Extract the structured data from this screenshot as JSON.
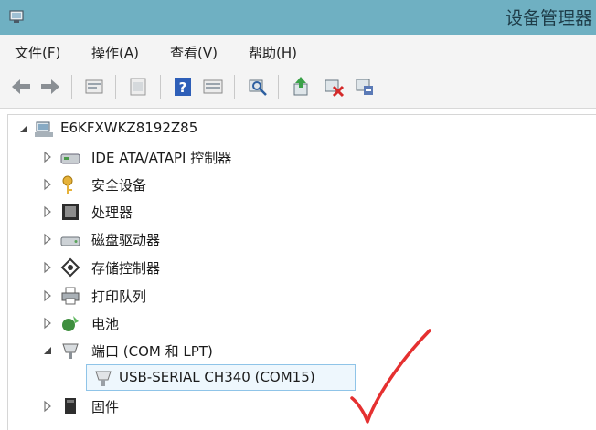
{
  "window": {
    "title": "设备管理器"
  },
  "menu": {
    "items": [
      "文件(F)",
      "操作(A)",
      "查看(V)",
      "帮助(H)"
    ]
  },
  "toolbar": {
    "buttons": [
      "back-arrow-icon",
      "forward-arrow-icon",
      "properties-icon",
      "show-hidden-icon",
      "help-icon",
      "view-icon",
      "scan-hardware-icon",
      "update-driver-icon",
      "disable-device-icon",
      "uninstall-device-icon"
    ]
  },
  "tree": {
    "root": "E6KFXWKZ8192Z85",
    "categories": [
      {
        "label": "IDE ATA/ATAPI 控制器",
        "expanded": false
      },
      {
        "label": "安全设备",
        "expanded": false
      },
      {
        "label": "处理器",
        "expanded": false
      },
      {
        "label": "磁盘驱动器",
        "expanded": false
      },
      {
        "label": "存储控制器",
        "expanded": false
      },
      {
        "label": "打印队列",
        "expanded": false
      },
      {
        "label": "电池",
        "expanded": false
      },
      {
        "label": "端口 (COM 和 LPT)",
        "expanded": true,
        "children": [
          "USB-SERIAL CH340 (COM15)"
        ]
      },
      {
        "label": "固件",
        "expanded": false
      }
    ]
  },
  "colors": {
    "titlebar": "#6fb0c2",
    "selection_border": "#8fc4e8",
    "annotation": "#e53030"
  }
}
